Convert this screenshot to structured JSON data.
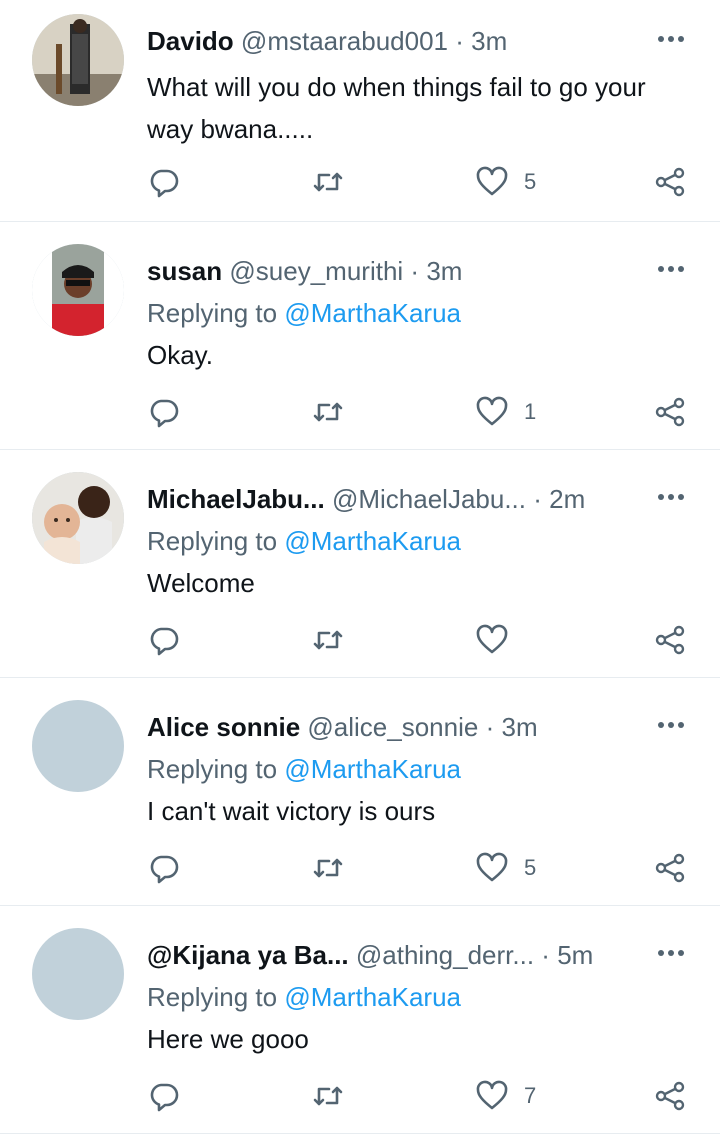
{
  "tweets": [
    {
      "name": "Davido",
      "handle": "@mstaarabud001",
      "separator": "·",
      "time": "3m",
      "replying_prefix": "",
      "replying_to": "",
      "text": "What will you do when things fail to go your way bwana.....",
      "likes": "5",
      "avatar": "photo"
    },
    {
      "name": "susan",
      "handle": "@suey_murithi",
      "separator": "·",
      "time": "3m",
      "replying_prefix": "Replying to",
      "replying_to": "@MarthaKarua",
      "text": "Okay.",
      "likes": "1",
      "avatar": "photo"
    },
    {
      "name": "MichaelJabu...",
      "handle": "@MichaelJabu...",
      "separator": "·",
      "time": "2m",
      "replying_prefix": "Replying to",
      "replying_to": "@MarthaKarua",
      "text": "Welcome",
      "likes": "",
      "avatar": "photo"
    },
    {
      "name": "Alice sonnie",
      "handle": "@alice_sonnie",
      "separator": "·",
      "time": "3m",
      "replying_prefix": "Replying to",
      "replying_to": "@MarthaKarua",
      "text": "I can't wait victory is ours",
      "likes": "5",
      "avatar": "blank"
    },
    {
      "name": "@Kijana ya Ba...",
      "handle": "@athing_derr...",
      "separator": "·",
      "time": "5m",
      "replying_prefix": "Replying to",
      "replying_to": "@MarthaKarua",
      "text": "Here we gooo",
      "likes": "7",
      "avatar": "blank"
    }
  ],
  "icons": {
    "more": "more-horizontal-icon",
    "reply": "comment-bubble-icon",
    "retweet": "retweet-arrows-icon",
    "like": "heart-outline-icon",
    "share": "share-nodes-icon"
  },
  "colors": {
    "text": "#0f1419",
    "secondary": "#536471",
    "mention": "#1d9bf0",
    "divider": "#e7ecf0",
    "placeholder_avatar": "#c1d1da"
  }
}
